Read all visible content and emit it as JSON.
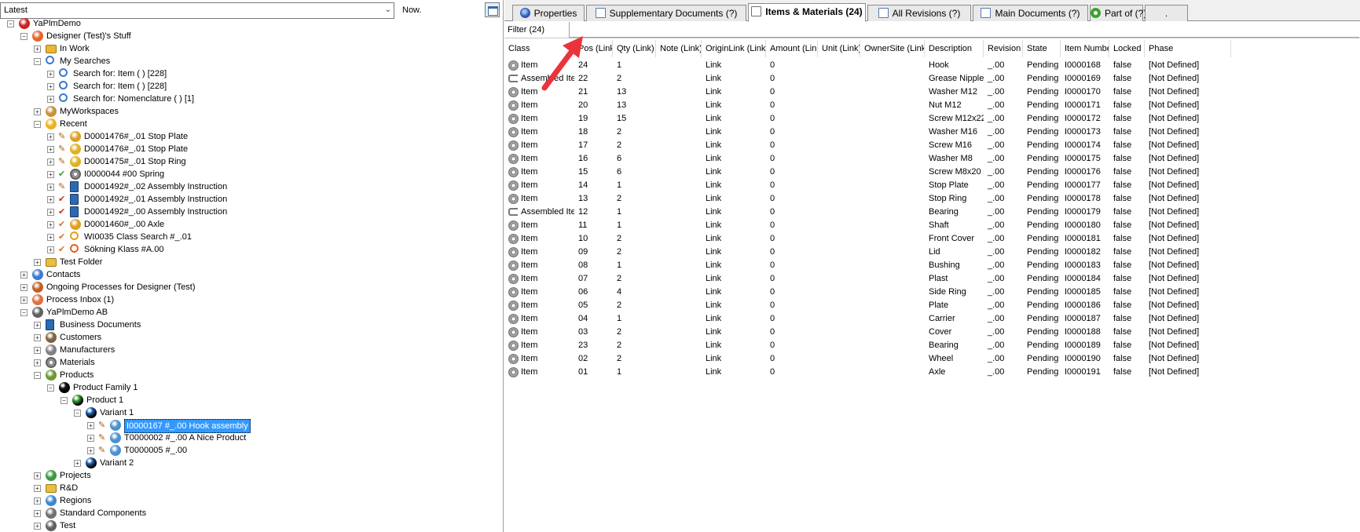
{
  "left_pane": {
    "version_select": "Latest",
    "now_label": "Now.",
    "tree": [
      {
        "label": "YaPlmDemo",
        "icon": "star-icon",
        "color": "#cc2222"
      },
      {
        "label": "Designer (Test)'s Stuff",
        "icon": "heart-icon",
        "color": "#e8632a"
      },
      {
        "label": "In Work",
        "icon": "folder-work-icon",
        "color": "#e8b830"
      },
      {
        "label": "My Searches",
        "icon": "search-icon",
        "color": "#3a7ad0"
      },
      {
        "label": "Search for: Item ( ) [228]",
        "icon": "search-icon",
        "color": "#3a7ad0"
      },
      {
        "label": "Search for: Item ( ) [228]",
        "icon": "search-icon",
        "color": "#3a7ad0"
      },
      {
        "label": "Search for: Nomenclature ( ) [1]",
        "icon": "search-icon",
        "color": "#3a7ad0"
      },
      {
        "label": "MyWorkspaces",
        "icon": "workspace-icon",
        "color": "#c89040"
      },
      {
        "label": "Recent",
        "icon": "star-recent-icon",
        "color": "#f0b020"
      },
      {
        "label": "D0001476#_.01 Stop Plate",
        "icon": "drawing-icon",
        "color": "#e0a020",
        "status": "pencil-icon"
      },
      {
        "label": "D0001476#_.01 Stop Plate",
        "icon": "model-icon",
        "color": "#e0b020",
        "status": "pencil-icon"
      },
      {
        "label": "D0001475#_.01 Stop Ring",
        "icon": "model-icon",
        "color": "#e0b020",
        "status": "pencil-icon"
      },
      {
        "label": "I0000044 #00 Spring",
        "icon": "gear-icon",
        "color": "#909090",
        "status": "check-icon"
      },
      {
        "label": "D0001492#_.02 Assembly Instruction",
        "icon": "document-icon",
        "color": "#2a6ab0",
        "status": "pencil-icon"
      },
      {
        "label": "D0001492#_.01 Assembly Instruction",
        "icon": "document-icon",
        "color": "#2a6ab0",
        "status": "check-red-icon"
      },
      {
        "label": "D0001492#_.00 Assembly Instruction",
        "icon": "document-icon",
        "color": "#2a6ab0",
        "status": "check-red-icon"
      },
      {
        "label": "D0001460#_.00 Axle",
        "icon": "drawing-icon",
        "color": "#e0a020",
        "status": "check-orange-icon"
      },
      {
        "label": "WI0035 Class Search #_.01",
        "icon": "class-search-icon",
        "color": "#e0a020",
        "status": "check-orange-icon"
      },
      {
        "label": "Sökning Klass #A.00",
        "icon": "globe-search-icon",
        "color": "#e86020",
        "status": "check-orange-icon"
      },
      {
        "label": "Test Folder",
        "icon": "folder-icon",
        "color": "#e8c040"
      },
      {
        "label": "Contacts",
        "icon": "contacts-icon",
        "color": "#3a7ad0"
      },
      {
        "label": "Ongoing Processes for Designer (Test)",
        "icon": "process-icon",
        "color": "#c06020"
      },
      {
        "label": "Process Inbox (1)",
        "icon": "inbox-icon",
        "color": "#e07040"
      },
      {
        "label": "YaPlmDemo AB",
        "icon": "house-icon",
        "color": "#606060"
      },
      {
        "label": "Business Documents",
        "icon": "document-icon",
        "color": "#2a6ab0"
      },
      {
        "label": "Customers",
        "icon": "customers-icon",
        "color": "#806040"
      },
      {
        "label": "Manufacturers",
        "icon": "factory-icon",
        "color": "#808080"
      },
      {
        "label": "Materials",
        "icon": "materials-icon",
        "color": "#909090"
      },
      {
        "label": "Products",
        "icon": "products-icon",
        "color": "#6a9a30"
      },
      {
        "label": "Product Family 1",
        "icon": "black-ball-icon",
        "color": "#111111"
      },
      {
        "label": "Product 1",
        "icon": "green-ball-icon",
        "color": "#3aa030"
      },
      {
        "label": "Variant 1",
        "icon": "blue-ball-icon",
        "color": "#2060b0"
      },
      {
        "label": "I0000167 #_.00 Hook assembly",
        "icon": "assembly-icon",
        "color": "#4a90d0",
        "status": "pencil-icon",
        "selected": true
      },
      {
        "label": "T0000002 #_.00 A Nice Product",
        "icon": "assembly-icon",
        "color": "#4a90d0",
        "status": "pencil-icon"
      },
      {
        "label": "T0000005 #_.00",
        "icon": "assembly-icon",
        "color": "#4a90d0",
        "status": "pencil-icon"
      },
      {
        "label": "Variant 2",
        "icon": "blue-ball-icon",
        "color": "#2060b0"
      },
      {
        "label": "Projects",
        "icon": "projects-icon",
        "color": "#3a9a40"
      },
      {
        "label": "R&D",
        "icon": "folder-icon",
        "color": "#e8c040"
      },
      {
        "label": "Regions",
        "icon": "globe-icon",
        "color": "#3a8ad0"
      },
      {
        "label": "Standard Components",
        "icon": "components-icon",
        "color": "#707070"
      },
      {
        "label": "Test",
        "icon": "test-icon",
        "color": "#606060"
      }
    ]
  },
  "tabs": [
    {
      "label": "Properties",
      "icon": "properties-icon",
      "color": "#2a5ab0"
    },
    {
      "label": "Supplementary Documents (?)",
      "icon": "document-icon",
      "color": "#5a7ab0"
    },
    {
      "label": "Items & Materials (24)",
      "icon": "items-icon",
      "color": "#707070",
      "active": true
    },
    {
      "label": "All Revisions (?)",
      "icon": "revisions-icon",
      "color": "#5a7ab0"
    },
    {
      "label": "Main Documents (?)",
      "icon": "document-icon",
      "color": "#5a7ab0"
    },
    {
      "label": "Part of (?)",
      "icon": "part-of-icon",
      "color": "#3aa030"
    },
    {
      "label": ".",
      "icon": "",
      "color": ""
    }
  ],
  "filter": {
    "label": "Filter (24)",
    "value": ""
  },
  "grid": {
    "columns": [
      "Class",
      "Pos (Link)",
      "Qty (Link)",
      "Note (Link)",
      "OriginLink (Link)",
      "Amount (Link)",
      "Unit (Link)",
      "OwnerSite (Link)",
      "Description",
      "Revision",
      "State",
      "Item Number",
      "Locked",
      "Phase"
    ],
    "rows": [
      {
        "cls": "Item",
        "pos": "24",
        "qty": "1",
        "note": "",
        "origin": "Link",
        "amount": "0",
        "unit": "",
        "owner": "",
        "desc": "Hook",
        "rev": "_.00",
        "state": "Pending",
        "num": "I0000168",
        "locked": "false",
        "phase": "[Not Defined]"
      },
      {
        "cls": "Assembled Item",
        "pos": "22",
        "qty": "2",
        "note": "",
        "origin": "Link",
        "amount": "0",
        "unit": "",
        "owner": "",
        "desc": "Grease Nipple",
        "rev": "_.00",
        "state": "Pending",
        "num": "I0000169",
        "locked": "false",
        "phase": "[Not Defined]"
      },
      {
        "cls": "Item",
        "pos": "21",
        "qty": "13",
        "note": "",
        "origin": "Link",
        "amount": "0",
        "unit": "",
        "owner": "",
        "desc": "Washer M12",
        "rev": "_.00",
        "state": "Pending",
        "num": "I0000170",
        "locked": "false",
        "phase": "[Not Defined]"
      },
      {
        "cls": "Item",
        "pos": "20",
        "qty": "13",
        "note": "",
        "origin": "Link",
        "amount": "0",
        "unit": "",
        "owner": "",
        "desc": "Nut M12",
        "rev": "_.00",
        "state": "Pending",
        "num": "I0000171",
        "locked": "false",
        "phase": "[Not Defined]"
      },
      {
        "cls": "Item",
        "pos": "19",
        "qty": "15",
        "note": "",
        "origin": "Link",
        "amount": "0",
        "unit": "",
        "owner": "",
        "desc": "Screw M12x22",
        "rev": "_.00",
        "state": "Pending",
        "num": "I0000172",
        "locked": "false",
        "phase": "[Not Defined]"
      },
      {
        "cls": "Item",
        "pos": "18",
        "qty": "2",
        "note": "",
        "origin": "Link",
        "amount": "0",
        "unit": "",
        "owner": "",
        "desc": "Washer M16",
        "rev": "_.00",
        "state": "Pending",
        "num": "I0000173",
        "locked": "false",
        "phase": "[Not Defined]"
      },
      {
        "cls": "Item",
        "pos": "17",
        "qty": "2",
        "note": "",
        "origin": "Link",
        "amount": "0",
        "unit": "",
        "owner": "",
        "desc": "Screw M16",
        "rev": "_.00",
        "state": "Pending",
        "num": "I0000174",
        "locked": "false",
        "phase": "[Not Defined]"
      },
      {
        "cls": "Item",
        "pos": "16",
        "qty": "6",
        "note": "",
        "origin": "Link",
        "amount": "0",
        "unit": "",
        "owner": "",
        "desc": "Washer M8",
        "rev": "_.00",
        "state": "Pending",
        "num": "I0000175",
        "locked": "false",
        "phase": "[Not Defined]"
      },
      {
        "cls": "Item",
        "pos": "15",
        "qty": "6",
        "note": "",
        "origin": "Link",
        "amount": "0",
        "unit": "",
        "owner": "",
        "desc": "Screw M8x20",
        "rev": "_.00",
        "state": "Pending",
        "num": "I0000176",
        "locked": "false",
        "phase": "[Not Defined]"
      },
      {
        "cls": "Item",
        "pos": "14",
        "qty": "1",
        "note": "",
        "origin": "Link",
        "amount": "0",
        "unit": "",
        "owner": "",
        "desc": "Stop Plate",
        "rev": "_.00",
        "state": "Pending",
        "num": "I0000177",
        "locked": "false",
        "phase": "[Not Defined]"
      },
      {
        "cls": "Item",
        "pos": "13",
        "qty": "2",
        "note": "",
        "origin": "Link",
        "amount": "0",
        "unit": "",
        "owner": "",
        "desc": "Stop Ring",
        "rev": "_.00",
        "state": "Pending",
        "num": "I0000178",
        "locked": "false",
        "phase": "[Not Defined]"
      },
      {
        "cls": "Assembled Item",
        "pos": "12",
        "qty": "1",
        "note": "",
        "origin": "Link",
        "amount": "0",
        "unit": "",
        "owner": "",
        "desc": "Bearing",
        "rev": "_.00",
        "state": "Pending",
        "num": "I0000179",
        "locked": "false",
        "phase": "[Not Defined]"
      },
      {
        "cls": "Item",
        "pos": "11",
        "qty": "1",
        "note": "",
        "origin": "Link",
        "amount": "0",
        "unit": "",
        "owner": "",
        "desc": "Shaft",
        "rev": "_.00",
        "state": "Pending",
        "num": "I0000180",
        "locked": "false",
        "phase": "[Not Defined]"
      },
      {
        "cls": "Item",
        "pos": "10",
        "qty": "2",
        "note": "",
        "origin": "Link",
        "amount": "0",
        "unit": "",
        "owner": "",
        "desc": "Front Cover",
        "rev": "_.00",
        "state": "Pending",
        "num": "I0000181",
        "locked": "false",
        "phase": "[Not Defined]"
      },
      {
        "cls": "Item",
        "pos": "09",
        "qty": "2",
        "note": "",
        "origin": "Link",
        "amount": "0",
        "unit": "",
        "owner": "",
        "desc": "Lid",
        "rev": "_.00",
        "state": "Pending",
        "num": "I0000182",
        "locked": "false",
        "phase": "[Not Defined]"
      },
      {
        "cls": "Item",
        "pos": "08",
        "qty": "1",
        "note": "",
        "origin": "Link",
        "amount": "0",
        "unit": "",
        "owner": "",
        "desc": "Bushing",
        "rev": "_.00",
        "state": "Pending",
        "num": "I0000183",
        "locked": "false",
        "phase": "[Not Defined]"
      },
      {
        "cls": "Item",
        "pos": "07",
        "qty": "2",
        "note": "",
        "origin": "Link",
        "amount": "0",
        "unit": "",
        "owner": "",
        "desc": "Plast",
        "rev": "_.00",
        "state": "Pending",
        "num": "I0000184",
        "locked": "false",
        "phase": "[Not Defined]"
      },
      {
        "cls": "Item",
        "pos": "06",
        "qty": "4",
        "note": "",
        "origin": "Link",
        "amount": "0",
        "unit": "",
        "owner": "",
        "desc": "Side Ring",
        "rev": "_.00",
        "state": "Pending",
        "num": "I0000185",
        "locked": "false",
        "phase": "[Not Defined]"
      },
      {
        "cls": "Item",
        "pos": "05",
        "qty": "2",
        "note": "",
        "origin": "Link",
        "amount": "0",
        "unit": "",
        "owner": "",
        "desc": "Plate",
        "rev": "_.00",
        "state": "Pending",
        "num": "I0000186",
        "locked": "false",
        "phase": "[Not Defined]"
      },
      {
        "cls": "Item",
        "pos": "04",
        "qty": "1",
        "note": "",
        "origin": "Link",
        "amount": "0",
        "unit": "",
        "owner": "",
        "desc": "Carrier",
        "rev": "_.00",
        "state": "Pending",
        "num": "I0000187",
        "locked": "false",
        "phase": "[Not Defined]"
      },
      {
        "cls": "Item",
        "pos": "03",
        "qty": "2",
        "note": "",
        "origin": "Link",
        "amount": "0",
        "unit": "",
        "owner": "",
        "desc": "Cover",
        "rev": "_.00",
        "state": "Pending",
        "num": "I0000188",
        "locked": "false",
        "phase": "[Not Defined]"
      },
      {
        "cls": "Item",
        "pos": "23",
        "qty": "2",
        "note": "",
        "origin": "Link",
        "amount": "0",
        "unit": "",
        "owner": "",
        "desc": "Bearing",
        "rev": "_.00",
        "state": "Pending",
        "num": "I0000189",
        "locked": "false",
        "phase": "[Not Defined]"
      },
      {
        "cls": "Item",
        "pos": "02",
        "qty": "2",
        "note": "",
        "origin": "Link",
        "amount": "0",
        "unit": "",
        "owner": "",
        "desc": "Wheel",
        "rev": "_.00",
        "state": "Pending",
        "num": "I0000190",
        "locked": "false",
        "phase": "[Not Defined]"
      },
      {
        "cls": "Item",
        "pos": "01",
        "qty": "1",
        "note": "",
        "origin": "Link",
        "amount": "0",
        "unit": "",
        "owner": "",
        "desc": "Axle",
        "rev": "_.00",
        "state": "Pending",
        "num": "I0000191",
        "locked": "false",
        "phase": "[Not Defined]"
      }
    ]
  },
  "annotation": {
    "arrow_color": "#e8343a"
  }
}
